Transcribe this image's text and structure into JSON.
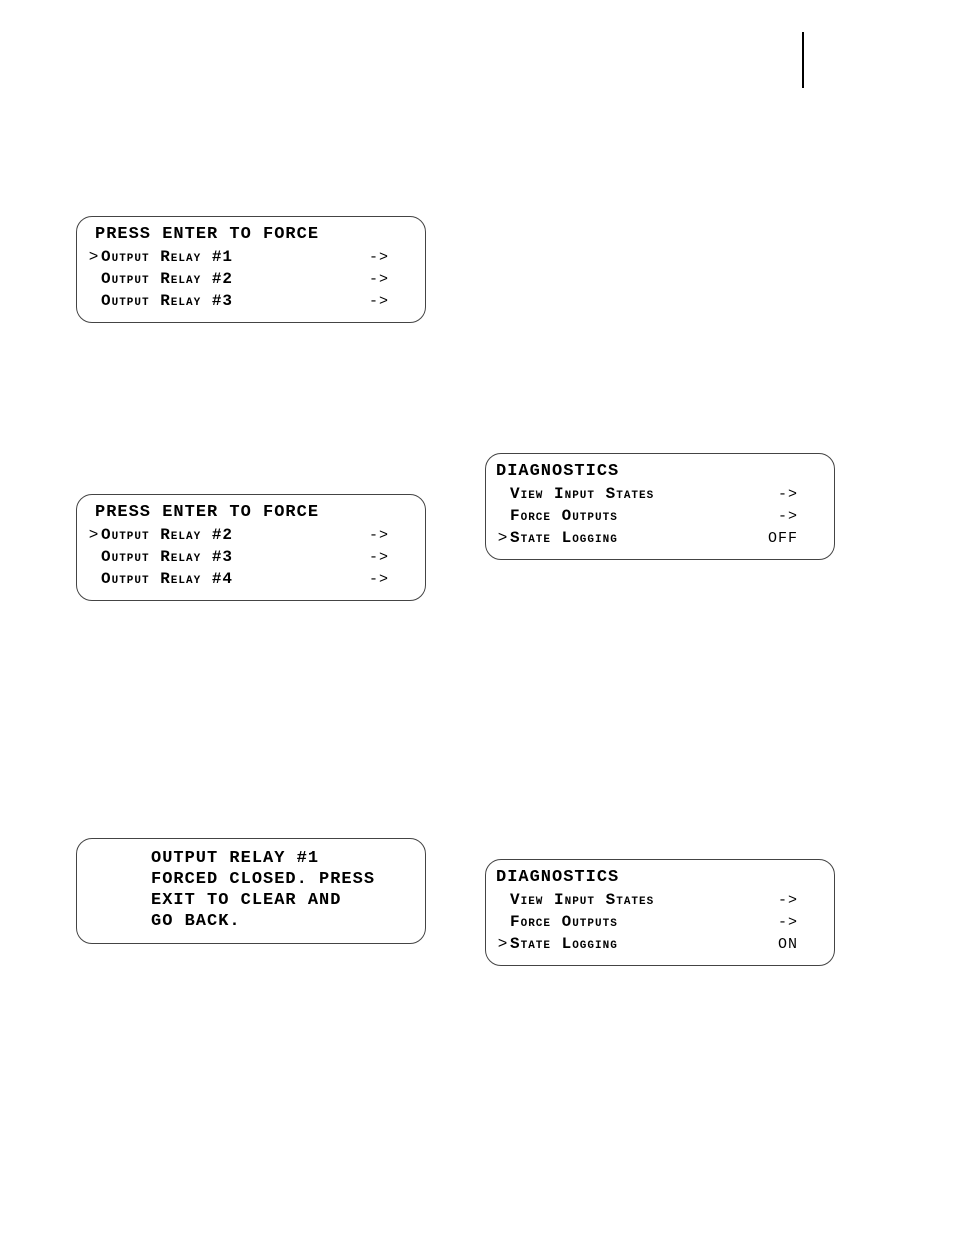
{
  "screen1": {
    "title": "PRESS ENTER TO FORCE",
    "rows": [
      {
        "cursor": ">",
        "label": "Output Relay #1",
        "value": "->"
      },
      {
        "cursor": "",
        "label": "Output Relay #2",
        "value": "->"
      },
      {
        "cursor": "",
        "label": "Output Relay #3",
        "value": "->"
      }
    ]
  },
  "screen2": {
    "title": "PRESS ENTER TO FORCE",
    "rows": [
      {
        "cursor": ">",
        "label": "Output Relay #2",
        "value": "->"
      },
      {
        "cursor": "",
        "label": "Output Relay #3",
        "value": "->"
      },
      {
        "cursor": "",
        "label": "Output Relay #4",
        "value": "->"
      }
    ]
  },
  "screen3": {
    "title": "DIAGNOSTICS",
    "rows": [
      {
        "cursor": "",
        "label": "View Input States",
        "value": "->"
      },
      {
        "cursor": "",
        "label": "Force Outputs",
        "value": "->"
      },
      {
        "cursor": ">",
        "label": "State Logging",
        "value": "OFF"
      }
    ]
  },
  "screen4": {
    "lines": [
      "OUTPUT RELAY #1",
      "FORCED CLOSED.  PRESS",
      "EXIT TO CLEAR AND",
      "GO BACK."
    ]
  },
  "screen5": {
    "title": "DIAGNOSTICS",
    "rows": [
      {
        "cursor": "",
        "label": "View Input States",
        "value": "->"
      },
      {
        "cursor": "",
        "label": "Force Outputs",
        "value": "->"
      },
      {
        "cursor": ">",
        "label": "State Logging",
        "value": "ON"
      }
    ]
  }
}
